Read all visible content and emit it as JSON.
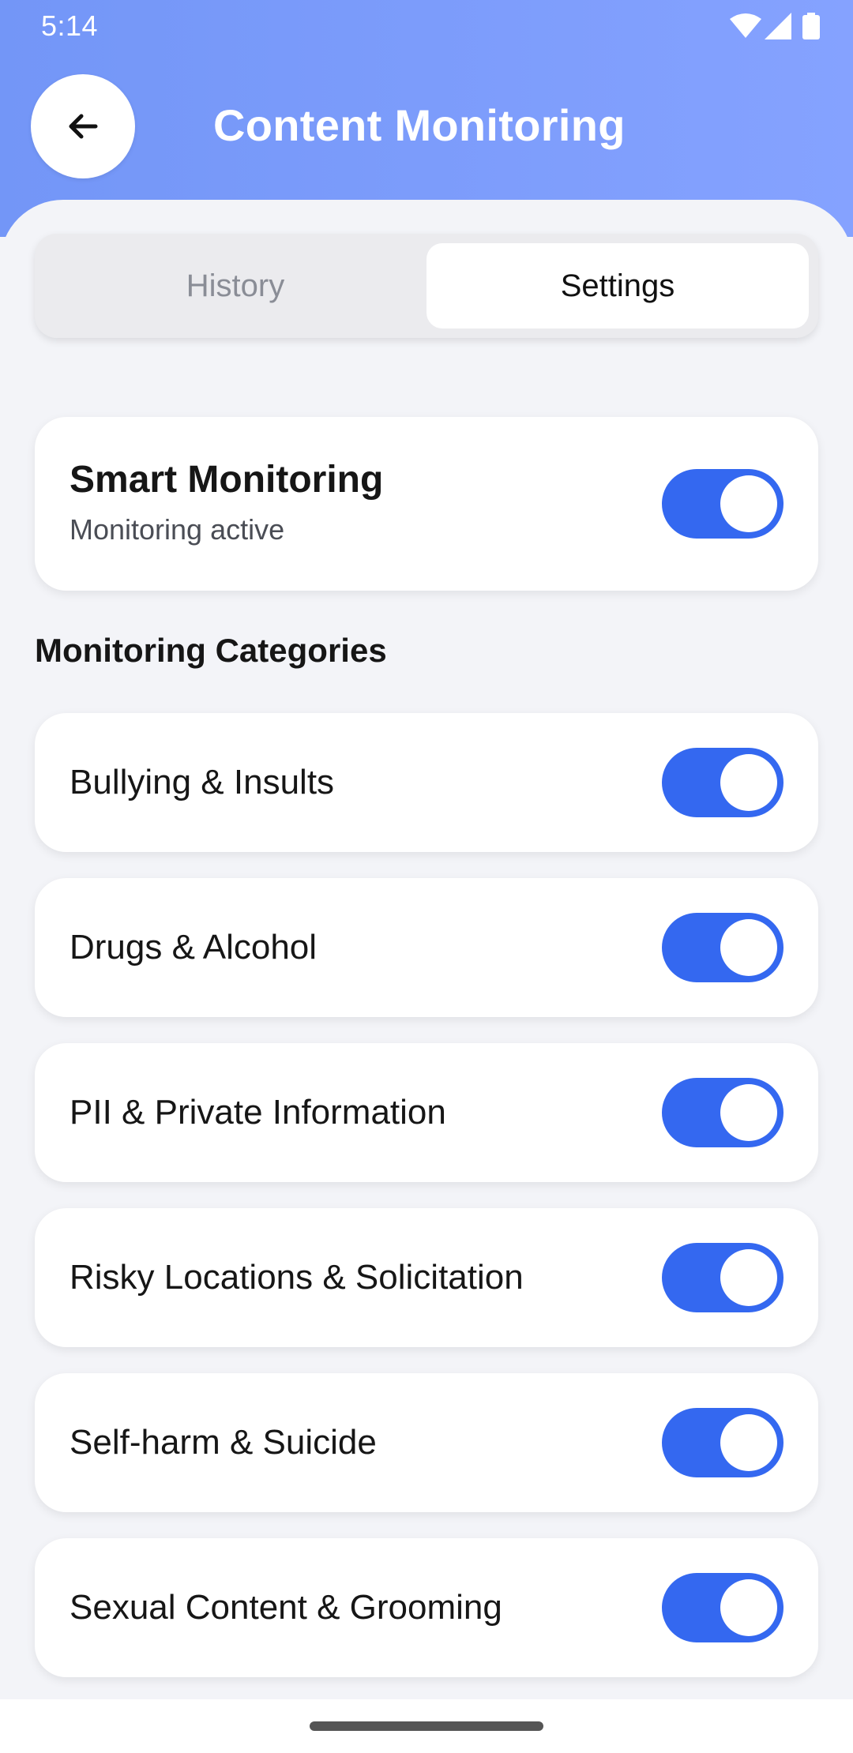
{
  "status_bar": {
    "time": "5:14",
    "icons": [
      "wifi-icon",
      "signal-icon",
      "battery-icon"
    ]
  },
  "header": {
    "title": "Content Monitoring",
    "back_icon": "arrow-left-icon"
  },
  "tabs": [
    {
      "label": "History",
      "selected": false
    },
    {
      "label": "Settings",
      "selected": true
    }
  ],
  "smart_monitoring": {
    "title": "Smart Monitoring",
    "subtitle": "Monitoring active",
    "enabled": true
  },
  "section_title": "Monitoring Categories",
  "categories": [
    {
      "label": "Bullying & Insults",
      "enabled": true
    },
    {
      "label": "Drugs & Alcohol",
      "enabled": true
    },
    {
      "label": "PII & Private Information",
      "enabled": true
    },
    {
      "label": "Risky Locations & Solicitation",
      "enabled": true
    },
    {
      "label": "Self-harm & Suicide",
      "enabled": true
    },
    {
      "label": "Sexual Content & Grooming",
      "enabled": true
    }
  ],
  "colors": {
    "header": "#7c9cf9",
    "toggle_on": "#3468f0",
    "background": "#f3f4f8"
  }
}
